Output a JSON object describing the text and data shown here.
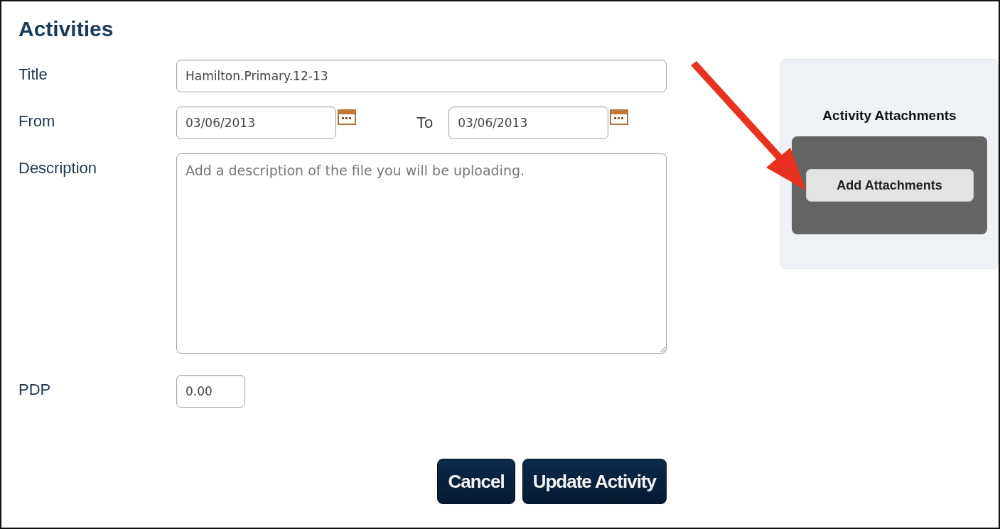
{
  "heading": "Activities",
  "fields": [
    {
      "kind": "text",
      "label": "Title",
      "value": "Hamilton.Primary.12-13"
    },
    {
      "kind": "daterange",
      "label": "From",
      "value": "03/06/2013",
      "to_label": "To",
      "to_value": "03/06/2013"
    },
    {
      "kind": "textarea",
      "label": "Description",
      "placeholder": "Add a description of the file you will be uploading."
    },
    {
      "kind": "number",
      "label": "PDP",
      "value": "0.00"
    }
  ],
  "buttons": [
    "Cancel",
    "Update Activity"
  ],
  "attachments": {
    "title": "Activity Attachments",
    "button": "Add Attachments"
  }
}
